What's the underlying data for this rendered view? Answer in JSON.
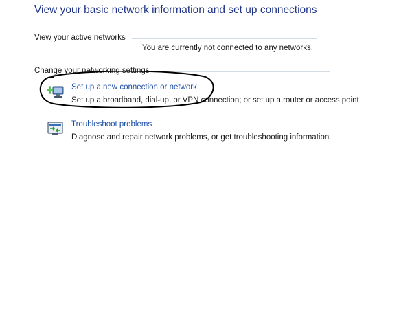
{
  "page": {
    "title": "View your basic network information and set up connections"
  },
  "active_networks": {
    "header": "View your active networks",
    "status": "You are currently not connected to any networks."
  },
  "networking_settings": {
    "header": "Change your networking settings",
    "tasks": [
      {
        "icon": "new-connection-icon",
        "link": "Set up a new connection or network",
        "description": "Set up a broadband, dial-up, or VPN connection; or set up a router or access point."
      },
      {
        "icon": "troubleshoot-icon",
        "link": "Troubleshoot problems",
        "description": "Diagnose and repair network problems, or get troubleshooting information."
      }
    ]
  },
  "colors": {
    "title": "#1e3287",
    "link": "#1e4fa8",
    "annotation": "#000000"
  }
}
